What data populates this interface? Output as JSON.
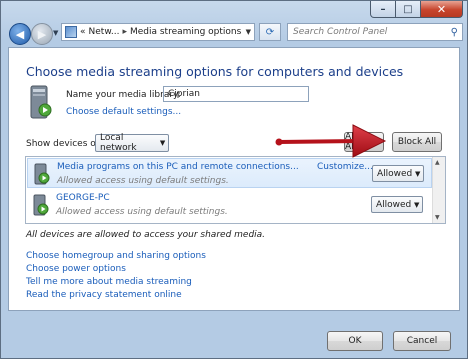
{
  "titlebar": {
    "minimize": "–",
    "maximize": "□",
    "close": "✕"
  },
  "nav": {
    "breadcrumb": {
      "prefix": "«",
      "item1": "Netw...",
      "item2": "Media streaming options"
    },
    "refresh": "⟳",
    "search_placeholder": "Search Control Panel"
  },
  "main": {
    "title": "Choose media streaming options for computers and devices",
    "library_label": "Name your media library:",
    "library_value": "Ciprian",
    "default_settings_link": "Choose default settings...",
    "show_devices_label": "Show devices on:",
    "show_devices_value": "Local network",
    "allow_all_label": "Allow All",
    "block_all_label": "Block All",
    "devices": [
      {
        "name": "Media programs on this PC and remote connections...",
        "desc": "Allowed access using default settings.",
        "customize": "Customize...",
        "status": "Allowed"
      },
      {
        "name": "GEORGE-PC",
        "desc": "Allowed access using default settings.",
        "status": "Allowed"
      }
    ],
    "all_allowed_text": "All devices are allowed to access your shared media.",
    "links": [
      "Choose homegroup and sharing options",
      "Choose power options",
      "Tell me more about media streaming",
      "Read the privacy statement online"
    ]
  },
  "footer": {
    "ok": "OK",
    "cancel": "Cancel"
  },
  "colors": {
    "title": "#1c3f8a",
    "link": "#1a5dba",
    "arrow": "#c0121c"
  }
}
